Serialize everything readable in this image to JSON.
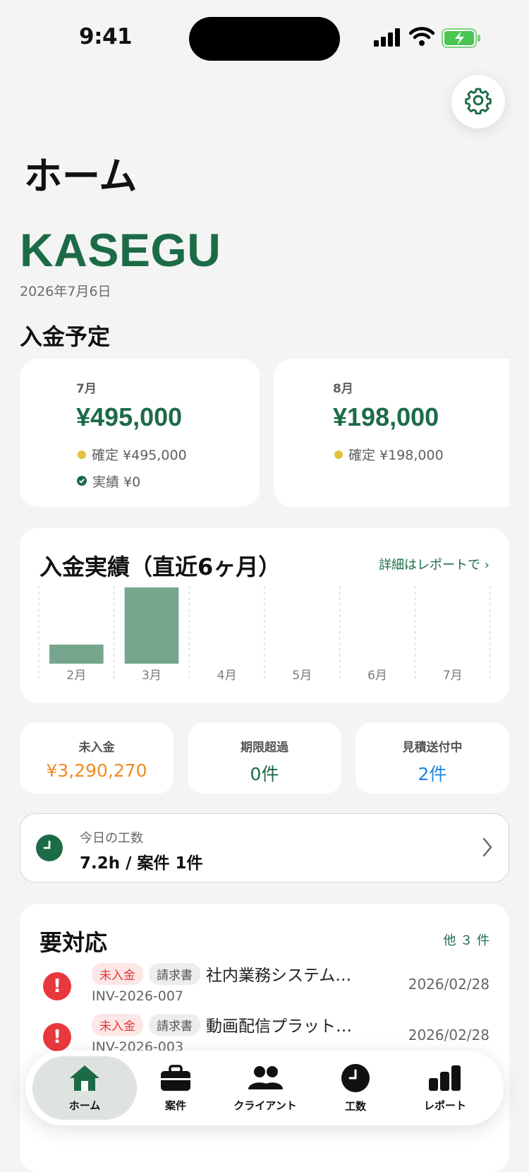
{
  "status": {
    "time": "9:41"
  },
  "header": {
    "title": "ホーム",
    "brand": "KASEGU",
    "date": "2026年7月6日"
  },
  "income_schedule": {
    "title": "入金予定",
    "cards": [
      {
        "month": "7月",
        "amount": "¥495,000",
        "confirmed": "確定 ¥495,000",
        "actual": "実績 ¥0"
      },
      {
        "month": "8月",
        "amount": "¥198,000",
        "confirmed": "確定 ¥198,000"
      }
    ]
  },
  "income_chart": {
    "title": "入金実績（直近6ヶ月）",
    "link": "詳細はレポートで",
    "link_chevron": "›"
  },
  "chart_data": {
    "type": "bar",
    "title": "入金実績（直近6ヶ月）",
    "categories": [
      "2月",
      "3月",
      "4月",
      "5月",
      "6月",
      "7月"
    ],
    "values": [
      25,
      100,
      0,
      0,
      0,
      0
    ],
    "bar_color": "#76a68d"
  },
  "stats": [
    {
      "label": "未入金",
      "value": "¥3,290,270",
      "color": "#f08a24"
    },
    {
      "label": "期限超過",
      "value": "0件",
      "color": "#1c6b47"
    },
    {
      "label": "見積送付中",
      "value": "2件",
      "color": "#1e86e0"
    }
  ],
  "today_work": {
    "label": "今日の工数",
    "value": "7.2h / 案件 1件",
    "icon": "clock-icon"
  },
  "action_required": {
    "title": "要対応",
    "more": "他 ３ 件",
    "items": [
      {
        "tag1": "未入金",
        "tag2": "請求書",
        "title": "社内業務システム…",
        "id": "INV-2026-007",
        "date": "2026/02/28"
      },
      {
        "tag1": "未入金",
        "tag2": "請求書",
        "title": "動画配信プラット…",
        "id": "INV-2026-003",
        "date": "2026/02/28"
      }
    ]
  },
  "tabbar": {
    "tabs": [
      {
        "label": "ホーム",
        "icon": "home-icon",
        "active": true
      },
      {
        "label": "案件",
        "icon": "briefcase-icon"
      },
      {
        "label": "クライアント",
        "icon": "people-icon"
      },
      {
        "label": "工数",
        "icon": "clock-icon"
      },
      {
        "label": "レポート",
        "icon": "bar-chart-icon"
      }
    ]
  },
  "colors": {
    "accent": "#1c6b47",
    "background": "#f3f4f3",
    "alert": "#e8383d"
  }
}
